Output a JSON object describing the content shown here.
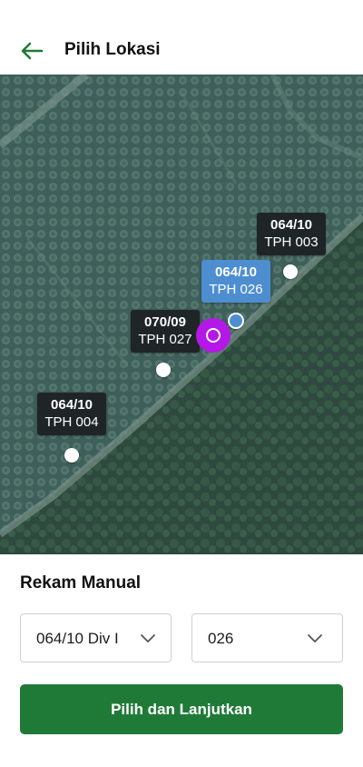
{
  "header": {
    "title": "Pilih Lokasi"
  },
  "map": {
    "markers": [
      {
        "code": "064/10",
        "name": "TPH 003",
        "selected": false
      },
      {
        "code": "064/10",
        "name": "TPH 026",
        "selected": true
      },
      {
        "code": "070/09",
        "name": "TPH 027",
        "selected": false
      },
      {
        "code": "064/10",
        "name": "TPH 004",
        "selected": false
      }
    ]
  },
  "manual": {
    "title": "Rekam Manual",
    "block_select": {
      "value": "064/10 Div I"
    },
    "tph_select": {
      "value": "026"
    }
  },
  "actions": {
    "continue_label": "Pilih dan Lanjutkan"
  },
  "colors": {
    "primary": "#1f7a38",
    "selected_marker": "#4d8ed1",
    "user_location": "#b517e6",
    "label_bg": "#1f2527"
  }
}
